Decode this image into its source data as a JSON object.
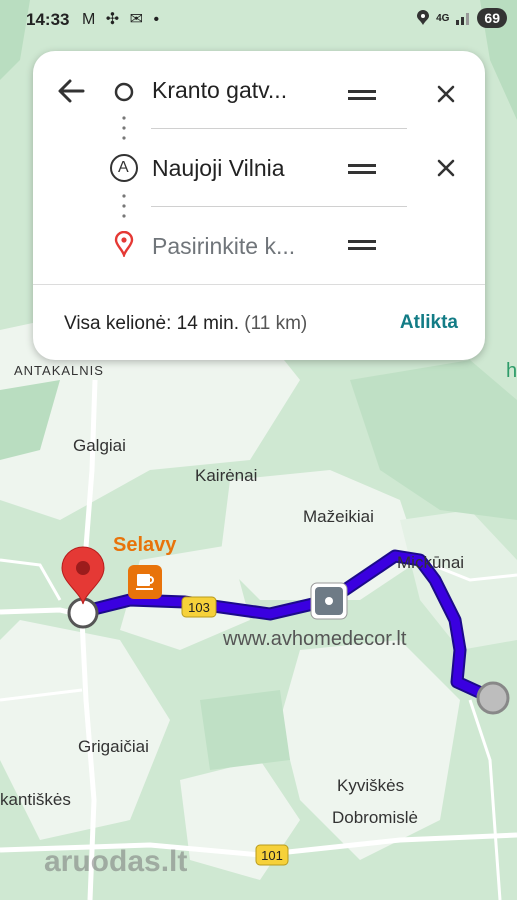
{
  "status_bar": {
    "time": "14:33",
    "notifications": "M ✣ ✉ •",
    "network": "4G",
    "battery": "69"
  },
  "directions": {
    "origin": "Kranto gatv...",
    "stop_a": "Naujoji Vilnia",
    "stop_a_marker": "A",
    "destination_placeholder": "Pasirinkite k...",
    "summary_label": "Visa kelionė: 14 min.",
    "summary_distance": "(11 km)",
    "done_label": "Atlikta"
  },
  "map": {
    "places": [
      {
        "id": "antakalnis",
        "name": "ANTAKALNIS"
      },
      {
        "id": "galgiai",
        "name": "Galgiai"
      },
      {
        "id": "kairenai",
        "name": "Kairėnai"
      },
      {
        "id": "mazeikiai",
        "name": "Mažeikiai"
      },
      {
        "id": "mickunai",
        "name": "Mickūnai"
      },
      {
        "id": "grigaiciai",
        "name": "Grigaičiai"
      },
      {
        "id": "antiskes",
        "name": "kantiškės"
      },
      {
        "id": "kyviskes",
        "name": "Kyviškės"
      },
      {
        "id": "dobromisle",
        "name": "Dobromislė"
      },
      {
        "id": "edge_h",
        "name": "h"
      }
    ],
    "poi_name": "Selavy",
    "road_103": "103",
    "road_101": "101",
    "watermark_url": "www.avhomedecor.lt",
    "watermark_brand": "aruodas.lt",
    "colors": {
      "route": "#3a00e0",
      "route_outline": "#1c0a8a",
      "poi": "#e8730a",
      "accent": "#137c86",
      "pin": "#e53935"
    }
  }
}
